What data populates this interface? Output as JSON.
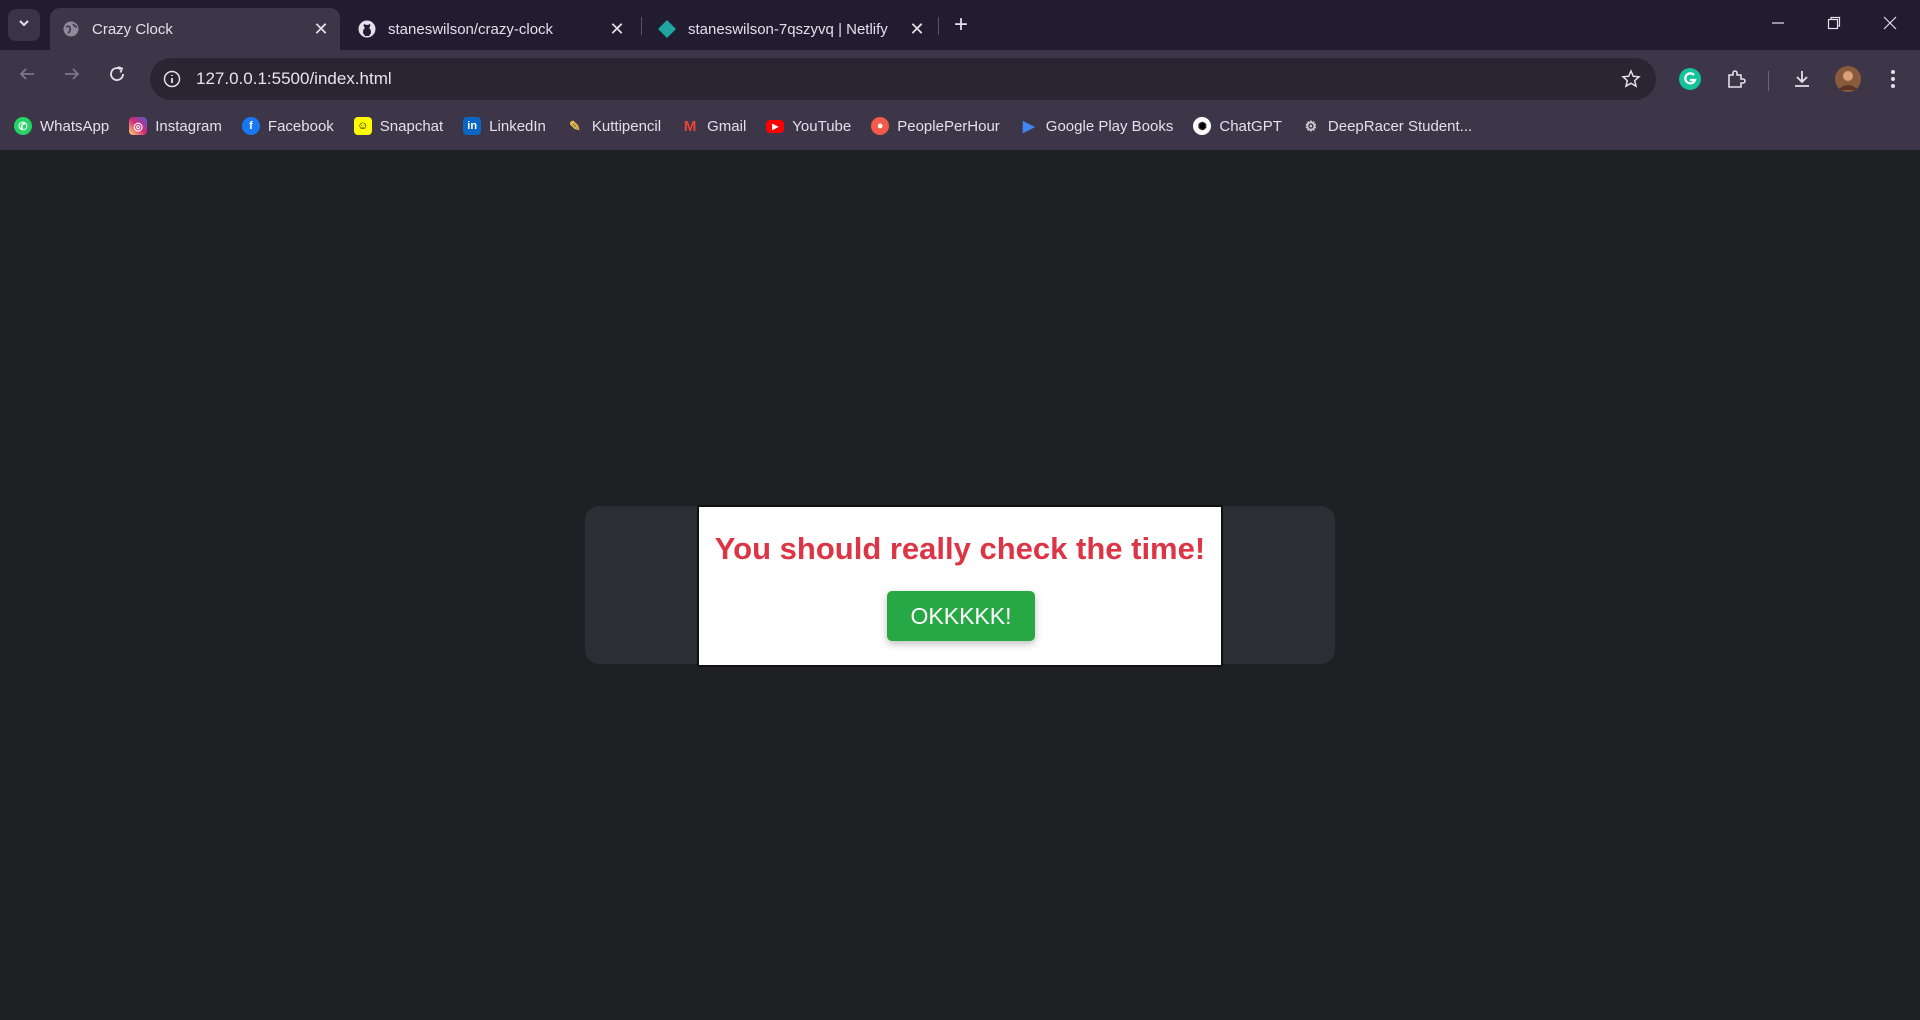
{
  "tabs": [
    {
      "title": "Crazy Clock",
      "icon": "globe-icon",
      "active": true
    },
    {
      "title": "staneswilson/crazy-clock",
      "icon": "github-icon",
      "active": false
    },
    {
      "title": "staneswilson-7qszyvq | Netlify",
      "icon": "netlify-icon",
      "active": false
    }
  ],
  "address_bar": {
    "url": "127.0.0.1:5500/index.html"
  },
  "bookmarks": [
    {
      "label": "WhatsApp",
      "icon": "whatsapp-icon",
      "color": "#25d366"
    },
    {
      "label": "Instagram",
      "icon": "instagram-icon",
      "color": "#d62976"
    },
    {
      "label": "Facebook",
      "icon": "facebook-icon",
      "color": "#1877f2"
    },
    {
      "label": "Snapchat",
      "icon": "snapchat-icon",
      "color": "#fffc00"
    },
    {
      "label": "LinkedIn",
      "icon": "linkedin-icon",
      "color": "#0a66c2"
    },
    {
      "label": "Kuttipencil",
      "icon": "pencil-icon",
      "color": "#e8b84a"
    },
    {
      "label": "Gmail",
      "icon": "gmail-icon",
      "color": "#ea4335"
    },
    {
      "label": "YouTube",
      "icon": "youtube-icon",
      "color": "#ff0000"
    },
    {
      "label": "PeoplePerHour",
      "icon": "peopleperhour-icon",
      "color": "#f25a4a"
    },
    {
      "label": "Google Play Books",
      "icon": "google-play-books-icon",
      "color": "#4285f4"
    },
    {
      "label": "ChatGPT",
      "icon": "chatgpt-icon",
      "color": "#ffffff"
    },
    {
      "label": "DeepRacer Student...",
      "icon": "deepracer-icon",
      "color": "#cccccc"
    }
  ],
  "modal": {
    "message": "You should really check the time!",
    "button_label": "OKKKKK!",
    "message_color": "#dc3545",
    "button_color": "#28a745"
  }
}
